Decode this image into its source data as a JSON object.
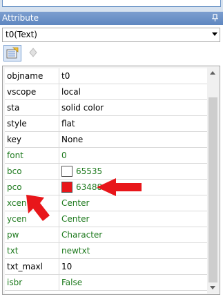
{
  "panel": {
    "title": "Attribute"
  },
  "selector": {
    "value": "t0(Text)"
  },
  "toolbar": {
    "buttons": [
      {
        "icon": "properties-icon"
      },
      {
        "icon": "events-icon"
      }
    ]
  },
  "rows": [
    {
      "name": "objname",
      "value": "t0",
      "green": false
    },
    {
      "name": "vscope",
      "value": "local",
      "green": false
    },
    {
      "name": "sta",
      "value": "solid color",
      "green": false
    },
    {
      "name": "style",
      "value": "flat",
      "green": false
    },
    {
      "name": "key",
      "value": "None",
      "green": false
    },
    {
      "name": "font",
      "value": "0",
      "green": true
    },
    {
      "name": "bco",
      "value": "65535",
      "green": true,
      "swatch": "#ffffff"
    },
    {
      "name": "pco",
      "value": "63488",
      "green": true,
      "swatch": "#e8161a"
    },
    {
      "name": "xcen",
      "value": "Center",
      "green": true
    },
    {
      "name": "ycen",
      "value": "Center",
      "green": true
    },
    {
      "name": "pw",
      "value": "Character",
      "green": true
    },
    {
      "name": "txt",
      "value": "newtxt",
      "green": true
    },
    {
      "name": "txt_maxl",
      "value": "10",
      "green": false
    },
    {
      "name": "isbr",
      "value": "False",
      "green": true
    }
  ],
  "annotation_color": "#e8161a"
}
